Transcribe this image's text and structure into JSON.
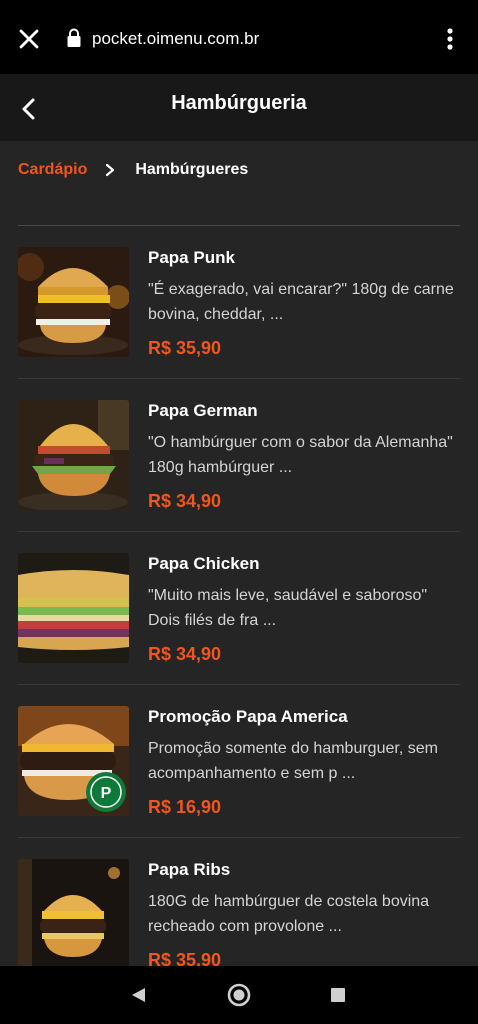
{
  "browser": {
    "url": "pocket.oimenu.com.br",
    "icons": {
      "close": "close-icon",
      "lock": "lock-icon",
      "menu": "more-vertical-icon"
    }
  },
  "header": {
    "title": "Hambúrgueria",
    "back_icon": "chevron-left-icon"
  },
  "breadcrumb": {
    "parent": "Cardápio",
    "current": "Hambúrgueres"
  },
  "colors": {
    "accent": "#f0561d",
    "background": "#252525",
    "header": "#181818",
    "bar": "#000000"
  },
  "items": [
    {
      "name": "Papa Punk",
      "description": "\"É exagerado, vai encarar?\" 180g de carne bovina, cheddar, ...",
      "price": "R$ 35,90"
    },
    {
      "name": "Papa German",
      "description": "\"O hambúrguer com o sabor da Alemanha\" 180g hambúrguer ...",
      "price": "R$ 34,90"
    },
    {
      "name": "Papa Chicken",
      "description": "\"Muito mais leve, saudável e saboroso\" Dois filés de fra ...",
      "price": "R$ 34,90"
    },
    {
      "name": "Promoção Papa America",
      "description": "Promoção somente do hamburguer, sem acompanhamento e sem p ...",
      "price": "R$ 16,90"
    },
    {
      "name": "Papa Ribs",
      "description": "180G de hambúrguer de costela bovina recheado com provolone ...",
      "price": "R$ 35,90"
    }
  ],
  "system_nav": {
    "icons": [
      "back-triangle-icon",
      "home-circle-icon",
      "recent-apps-icon"
    ]
  }
}
